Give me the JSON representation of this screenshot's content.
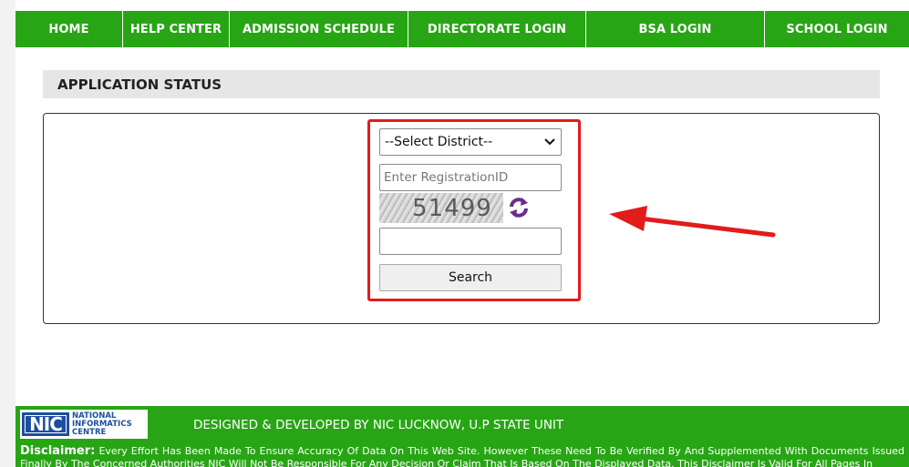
{
  "nav": {
    "items": [
      {
        "label": "HOME"
      },
      {
        "label": "HELP CENTER"
      },
      {
        "label": "ADMISSION SCHEDULE"
      },
      {
        "label": "DIRECTORATE LOGIN"
      },
      {
        "label": "BSA LOGIN"
      },
      {
        "label": "SCHOOL LOGIN"
      }
    ]
  },
  "section": {
    "title": "APPLICATION STATUS"
  },
  "form": {
    "district_select": "--Select District--",
    "registration_placeholder": "Enter RegistrationID",
    "captcha_text": "51499",
    "captcha_input_value": "",
    "search_label": "Search"
  },
  "footer": {
    "logo_text": [
      "NATIONAL",
      "INFORMATICS",
      "CENTRE"
    ],
    "logo_mark": "NIC",
    "credit": "DESIGNED & DEVELOPED BY NIC LUCKNOW, U.P STATE UNIT",
    "disclaimer_label": "Disclaimer:",
    "disclaimer_text": "Every Effort Has Been Made To Ensure Accuracy Of Data On This Web Site. However These Need To Be Verified By And Supplemented With Documents Issued Finally By The Concerned Authorities NIC Will Not Be Responsible For Any Decision Or Claim That Is Based On The Displayed Data. This Disclaimer Is Valid For All Pages In"
  },
  "colors": {
    "nav_bg": "#27a514",
    "highlight": "#e21b1b",
    "refresh_icon": "#6a2c8e"
  },
  "icons": {
    "refresh": "refresh-icon",
    "arrow": "arrow-left-icon",
    "dropdown": "chevron-down-icon"
  }
}
